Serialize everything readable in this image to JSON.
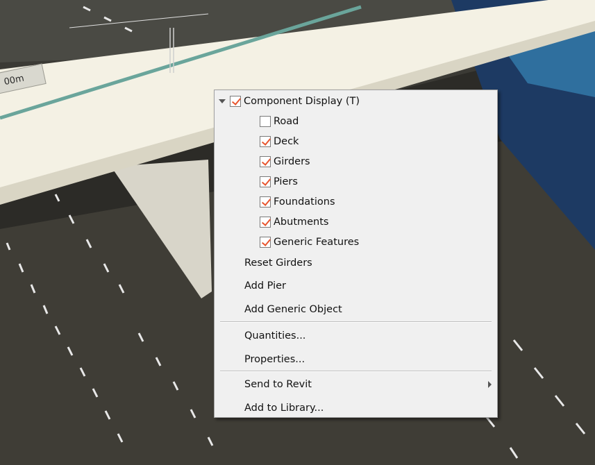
{
  "ruler": {
    "label": "00m"
  },
  "menu": {
    "group": {
      "label": "Component Display (T)",
      "checked": true,
      "expander_icon": "triangle-down-icon"
    },
    "components": [
      {
        "label": "Road",
        "checked": false
      },
      {
        "label": "Deck",
        "checked": true
      },
      {
        "label": "Girders",
        "checked": true
      },
      {
        "label": "Piers",
        "checked": true
      },
      {
        "label": "Foundations",
        "checked": true
      },
      {
        "label": "Abutments",
        "checked": true
      },
      {
        "label": "Generic Features",
        "checked": true
      }
    ],
    "commands": [
      {
        "label": "Reset Girders"
      },
      {
        "label": "Add Pier"
      },
      {
        "label": "Add Generic Object"
      }
    ],
    "commands2": [
      {
        "label": "Quantities..."
      },
      {
        "label": "Properties..."
      }
    ],
    "commands3": [
      {
        "label": "Send to Revit",
        "has_submenu": true
      },
      {
        "label": "Add to Library..."
      }
    ]
  },
  "colors": {
    "check_accent": "#e8552e",
    "menu_bg": "#f0f0f0",
    "deck": "#f4f1e4",
    "median_stripe": "#6aa59b"
  }
}
